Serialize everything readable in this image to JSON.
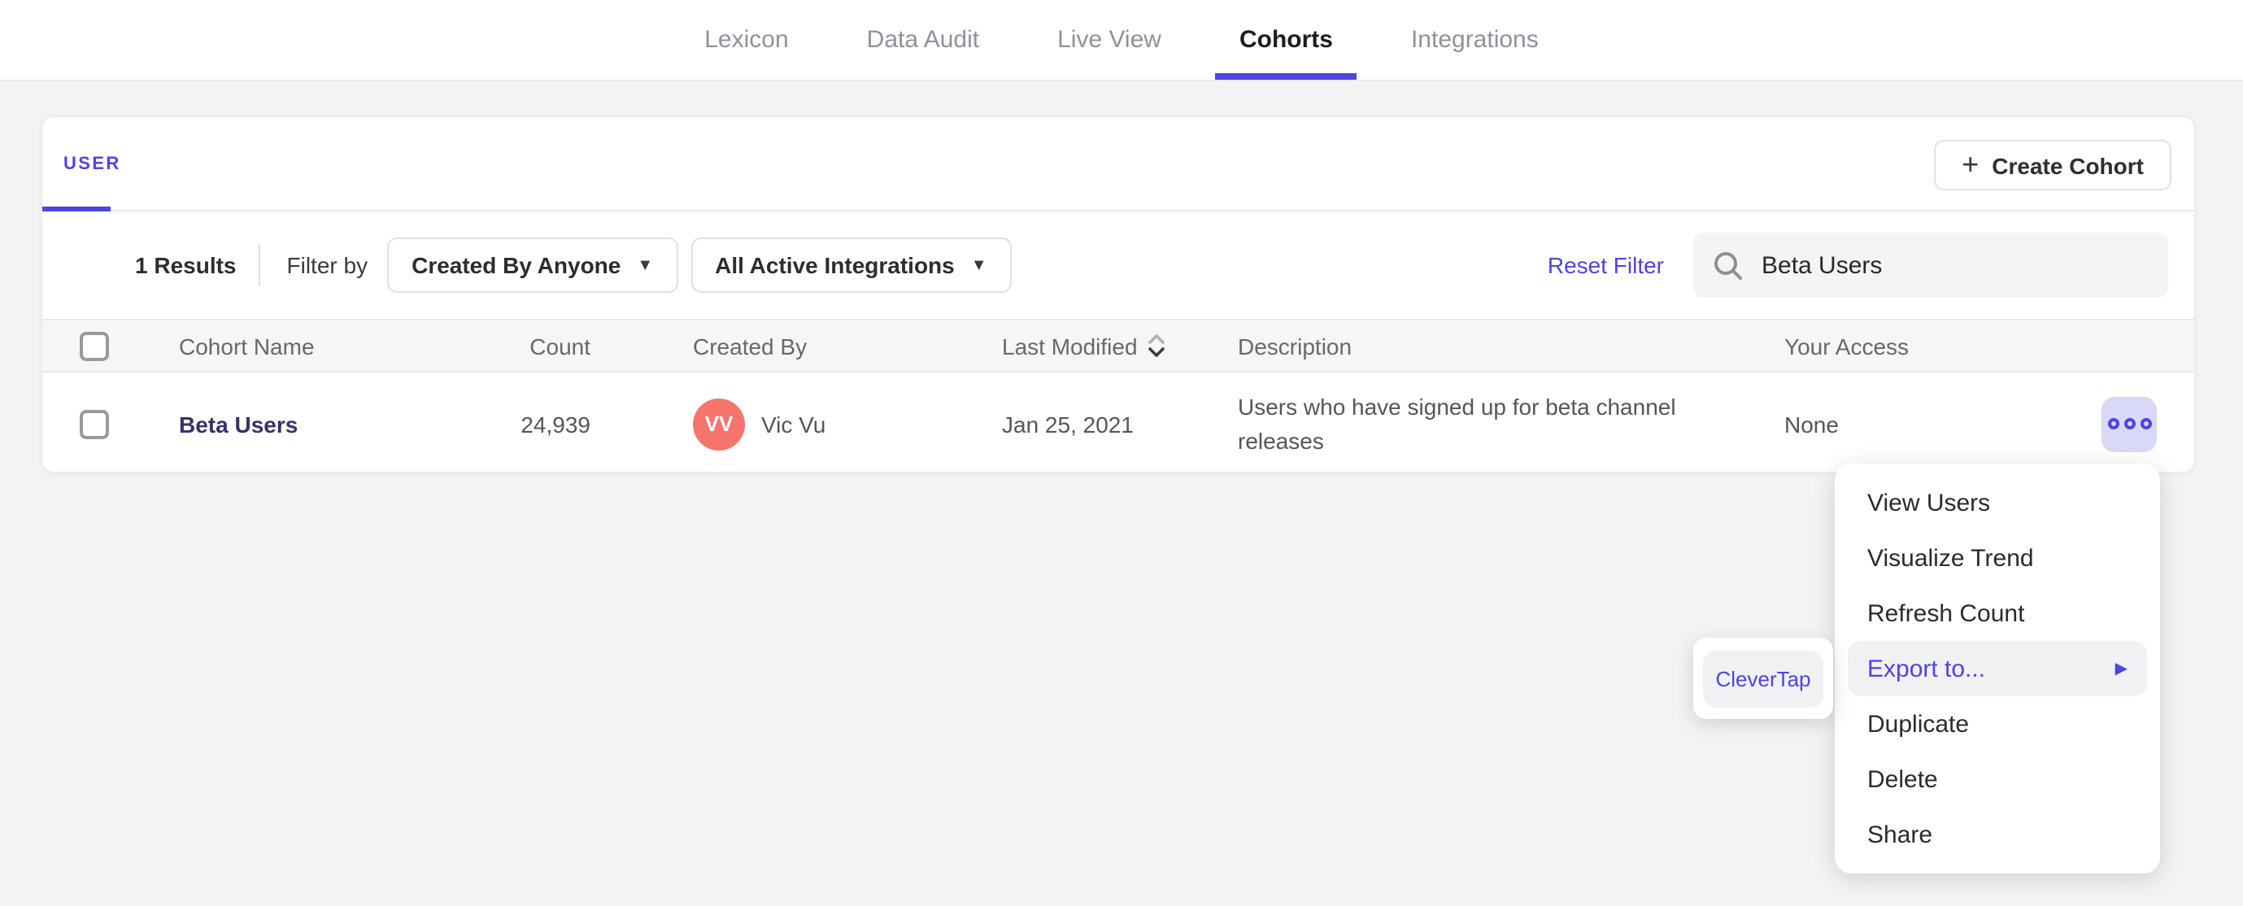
{
  "nav": {
    "items": [
      {
        "label": "Lexicon",
        "active": false
      },
      {
        "label": "Data Audit",
        "active": false
      },
      {
        "label": "Live View",
        "active": false
      },
      {
        "label": "Cohorts",
        "active": true
      },
      {
        "label": "Integrations",
        "active": false
      }
    ]
  },
  "panel": {
    "tab_label": "USER",
    "create_button_label": "Create Cohort",
    "filter_bar": {
      "results_count": "1 Results",
      "filter_by_label": "Filter by",
      "created_by_value": "Created By Anyone",
      "integrations_value": "All Active Integrations",
      "reset_label": "Reset Filter",
      "search_value": "Beta Users"
    }
  },
  "table": {
    "columns": [
      "Cohort Name",
      "Count",
      "Created By",
      "Last Modified",
      "Description",
      "Your Access"
    ],
    "rows": [
      {
        "name": "Beta Users",
        "count": "24,939",
        "avatar_initials": "VV",
        "created_by": "Vic Vu",
        "last_modified": "Jan 25, 2021",
        "description": "Users who have signed up for beta channel releases",
        "access": "None"
      }
    ]
  },
  "context_menu": {
    "items": [
      "View Users",
      "Visualize Trend",
      "Refresh Count",
      "Export to...",
      "Duplicate",
      "Delete",
      "Share"
    ],
    "highlighted_item": "Export to...",
    "submenu": {
      "items": [
        "CleverTap"
      ],
      "highlighted_item": "CleverTap"
    }
  },
  "colors": {
    "accent": "#4f44e0",
    "cohort_link": "#36316e",
    "avatar": "#f5756c",
    "menu_highlight": "#f1f1f4",
    "actions_button_bg": "#d9d8f6",
    "page_bg": "#f3f3f4"
  }
}
